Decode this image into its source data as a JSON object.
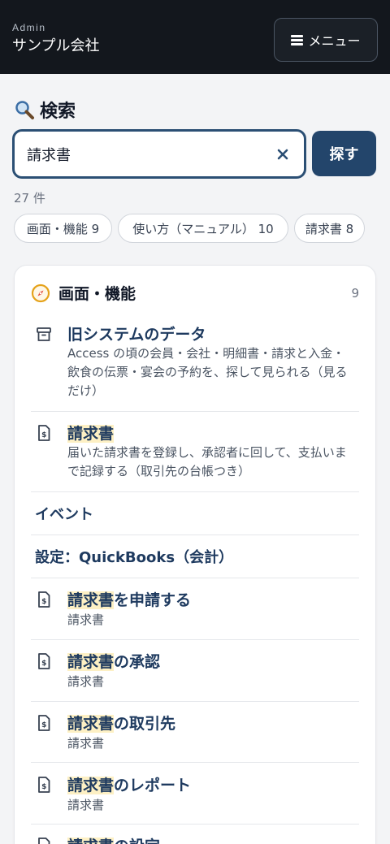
{
  "header": {
    "kicker": "Admin",
    "company": "サンプル会社",
    "menu_label": "メニュー"
  },
  "search": {
    "title": "検索",
    "value": "請求書",
    "button_label": "探す",
    "result_count": "27 件"
  },
  "filters": [
    {
      "label": "画面・機能 9"
    },
    {
      "label": "使い方（マニュアル） 10"
    },
    {
      "label": "請求書 8"
    }
  ],
  "section": {
    "title": "画面・機能",
    "count": "9",
    "items": [
      {
        "title": "旧システムのデータ",
        "description": "Access の頃の会員・会社・明細書・請求と入金・飲食の伝票・宴会の予約を、探して見られる（見るだけ）",
        "icon": "archive-icon"
      },
      {
        "title_hl": "請求書",
        "title_rest": "",
        "description": "届いた請求書を登録し、承認者に回して、支払いまで記録する（取引先の台帳つき）",
        "icon": "invoice-icon"
      },
      {
        "title": "イベント"
      },
      {
        "title": "設定：QuickBooks（会計）"
      },
      {
        "title_hl": "請求書",
        "title_rest": "を申請する",
        "sub": "請求書",
        "icon": "invoice-icon"
      },
      {
        "title_hl": "請求書",
        "title_rest": "の承認",
        "sub": "請求書",
        "icon": "invoice-icon"
      },
      {
        "title_hl": "請求書",
        "title_rest": "の取引先",
        "sub": "請求書",
        "icon": "invoice-icon"
      },
      {
        "title_hl": "請求書",
        "title_rest": "のレポート",
        "sub": "請求書",
        "icon": "invoice-icon"
      },
      {
        "title_hl": "請求書",
        "title_rest": "の設定",
        "icon": "invoice-icon"
      }
    ]
  },
  "colors": {
    "header_bg": "#13171d",
    "accent": "#23456b",
    "highlight": "#fdf0c4",
    "link": "#1e3a5f"
  }
}
